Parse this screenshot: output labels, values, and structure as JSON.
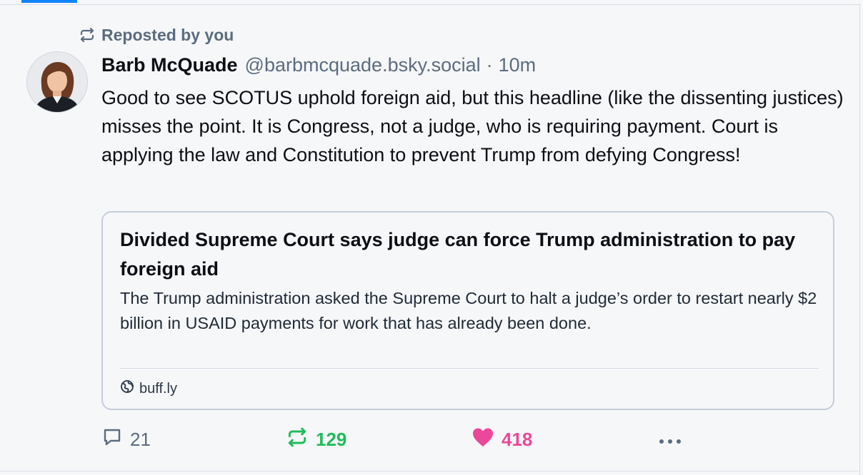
{
  "repost_banner": {
    "icon": "repost-icon",
    "label": "Reposted by you"
  },
  "post": {
    "author": {
      "display_name": "Barb McQuade",
      "handle": "@barbmcquade.bsky.social"
    },
    "separator": "·",
    "time": "10m",
    "text": "Good to see SCOTUS uphold foreign aid, but this headline (like the dissenting justices) misses the point. It is Congress, not a judge, who is requiring payment. Court is applying the law and Constitution to prevent Trump from defying Congress!"
  },
  "link_card": {
    "title": "Divided Supreme Court says judge can force Trump administration to pay foreign aid",
    "description": "The Trump administration asked the Supreme Court to halt a judge’s order to restart nearly $2 billion in USAID payments for work that has already been done.",
    "domain_icon": "globe-icon",
    "domain": "buff.ly"
  },
  "actions": {
    "reply": {
      "icon": "comment-icon",
      "count": "21"
    },
    "repost": {
      "icon": "repost-icon",
      "count": "129",
      "active": true
    },
    "like": {
      "icon": "heart-icon",
      "count": "418",
      "active": true
    },
    "more": {
      "icon": "ellipsis-icon"
    }
  },
  "colors": {
    "muted": "#5b6c80",
    "repost_active": "#20bc5a",
    "like_active": "#ec4899",
    "accent": "#1083fe"
  }
}
